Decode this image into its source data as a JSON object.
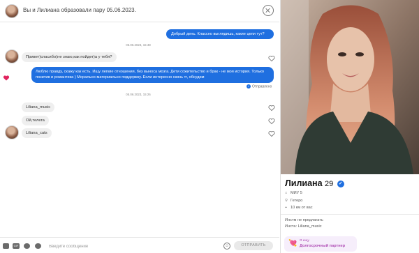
{
  "header": {
    "title": "Вы и Лилиана образовали пару 05.06.2023."
  },
  "messages": {
    "m1_out": "Добрый день. Классно выглядишь, какие цели тут?",
    "ts1": "05.06.2023, 15:48",
    "m2_in": "Привет)спасибо)не знаю,как пойдет)а у тебя?",
    "m3_out": "Люблю правду, скажу как есть. Ищу легкие отношения, без выноса мозга. Дети сожительство и брак - не моя история. Только позитив и романтика ) Морально-материально поддержку. Если интересно скинь тг, обсудим",
    "sent_status": "Отправлено",
    "ts2": "05.06.2023, 15:26",
    "m4_in": "Liliana_music",
    "m5_in": "Ой,телега",
    "m6_in": "Liliana_cats"
  },
  "composer": {
    "placeholder": "Введите сообщение",
    "send_label": "ОТПРАВИТЬ",
    "gif_label": "GIF"
  },
  "profile": {
    "name": "Лилиана",
    "age": "29",
    "education": "МИУ 5",
    "orientation": "Гетеро",
    "distance": "10 км от вас",
    "bio_line1": "Инстм не предлагать",
    "bio_line2": "Инста: Liliana_music",
    "seeking_label": "Я ищу",
    "seeking_value": "Долгосрочный партнер"
  },
  "colors": {
    "accent": "#1f6fe0",
    "like": "#e0245e",
    "seek": "#b04fb6"
  }
}
